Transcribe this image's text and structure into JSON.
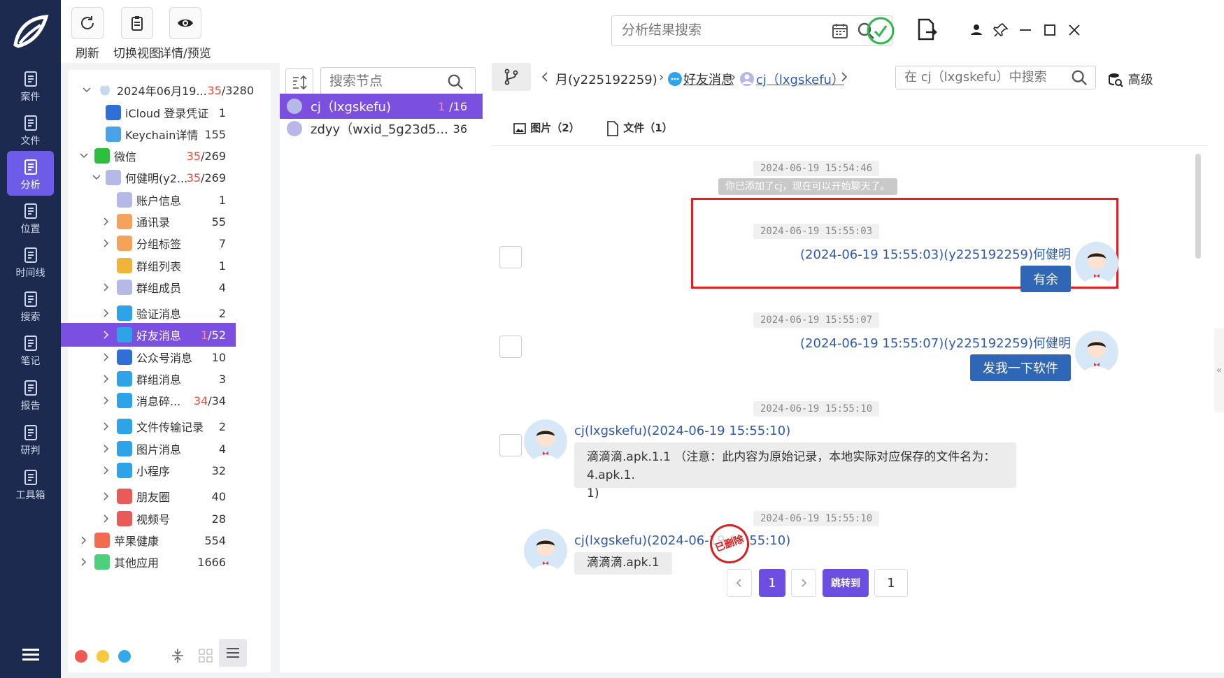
{
  "toolbar": {
    "refresh": "刷新",
    "switch_view": "切换视图",
    "detail_preview": "详情/预览",
    "search_placeholder": "分析结果搜索"
  },
  "nav": [
    {
      "label": "案件",
      "icon": "case-icon"
    },
    {
      "label": "文件",
      "icon": "folder-icon"
    },
    {
      "label": "分析",
      "icon": "analysis-icon",
      "active": true
    },
    {
      "label": "位置",
      "icon": "location-icon"
    },
    {
      "label": "时间线",
      "icon": "timeline-icon"
    },
    {
      "label": "搜索",
      "icon": "search-icon"
    },
    {
      "label": "笔记",
      "icon": "note-icon"
    },
    {
      "label": "报告",
      "icon": "report-icon"
    },
    {
      "label": "研判",
      "icon": "judge-icon"
    },
    {
      "label": "工具箱",
      "icon": "toolbox-icon"
    }
  ],
  "tree": {
    "root": {
      "label": "2024年06月19...",
      "count_red": "35",
      "count": "/3280"
    },
    "items": [
      {
        "label": "iCloud 登录凭证",
        "count": "1",
        "level": 2,
        "color": "#2f6fd6"
      },
      {
        "label": "Keychain详情",
        "count": "155",
        "level": 2,
        "color": "#4aa3e8"
      },
      {
        "label": "微信",
        "count_red": "35",
        "count": "/269",
        "level": 1,
        "color": "#2fbf3f"
      },
      {
        "label": "何健明(y2...",
        "count_red": "35",
        "count": "/269",
        "level": 2,
        "color": "#b6b8e8"
      },
      {
        "label": "账户信息",
        "count": "1",
        "level": 3,
        "color": "#b6b8e8"
      },
      {
        "label": "通讯录",
        "count": "55",
        "level": 3,
        "color": "#f5a35a"
      },
      {
        "label": "分组标签",
        "count": "7",
        "level": 3,
        "color": "#f5a35a"
      },
      {
        "label": "群组列表",
        "count": "1",
        "level": 3,
        "color": "#f0b43c"
      },
      {
        "label": "群组成员",
        "count": "4",
        "level": 3,
        "color": "#b6b8e8"
      },
      {
        "label": "验证消息",
        "count": "2",
        "level": 3,
        "color": "#2ea3e8"
      },
      {
        "label": "好友消息",
        "count_red": "1",
        "count": "/52",
        "level": 3,
        "color": "#2ea3e8",
        "selected": true
      },
      {
        "label": "公众号消息",
        "count": "10",
        "level": 3,
        "color": "#2f6fd6"
      },
      {
        "label": "群组消息",
        "count": "3",
        "level": 3,
        "color": "#2ea3e8"
      },
      {
        "label": "消息碎...",
        "count_red": "34",
        "count": "/34",
        "level": 3,
        "color": "#2ea3e8"
      },
      {
        "label": "文件传输记录",
        "count": "2",
        "level": 3,
        "color": "#2ea3e8"
      },
      {
        "label": "图片消息",
        "count": "4",
        "level": 3,
        "color": "#2ea3e8"
      },
      {
        "label": "小程序",
        "count": "32",
        "level": 3,
        "color": "#2ea3e8"
      },
      {
        "label": "朋友圈",
        "count": "40",
        "level": 3,
        "color": "#e85b5b"
      },
      {
        "label": "视频号",
        "count": "28",
        "level": 3,
        "color": "#e85b5b"
      },
      {
        "label": "苹果健康",
        "count": "554",
        "level": 1,
        "color": "#f26b50"
      },
      {
        "label": "其他应用",
        "count": "1666",
        "level": 1,
        "color": "#4cd07a"
      }
    ]
  },
  "contacts": {
    "search_placeholder": "搜索节点",
    "items": [
      {
        "label": "cj（lxgskefu)",
        "count_red": "1",
        "count": "/16",
        "selected": true
      },
      {
        "label": "zdyy（wxid_5g23d5...",
        "count": "36"
      }
    ]
  },
  "chat": {
    "crumb_account": "月(y225192259)",
    "crumb_category": "好友消息",
    "crumb_contact": "cj（lxgskefu）",
    "search_placeholder": "在 cj（lxgskefu）中搜索",
    "advanced": "高级",
    "tab_images": "图片（2）",
    "tab_files": "文件（1）",
    "messages": [
      {
        "ts": "2024-06-19 15:54:46",
        "system": "你已添加了cj，现在可以开始聊天了。"
      },
      {
        "ts": "2024-06-19 15:55:03",
        "sender": "(2024-06-19 15:55:03)(y225192259)何健明",
        "text": "有余",
        "dir": "out"
      },
      {
        "ts": "2024-06-19 15:55:07",
        "sender": "(2024-06-19 15:55:07)(y225192259)何健明",
        "text": "发我一下软件",
        "dir": "out"
      },
      {
        "ts": "2024-06-19 15:55:10",
        "sender": "cj(lxgskefu)(2024-06-19 15:55:10)",
        "text": "滴滴滴.apk.1.1 （注意：此内容为原始记录，本地实际对应保存的文件名为：4.apk.1.",
        "text2": "1)",
        "dir": "in"
      },
      {
        "ts": "2024-06-19 15:55:10",
        "sender": "cj(lxgskefu)(2024-06-19 15:55:10)",
        "text": "滴滴滴.apk.1",
        "dir": "in",
        "stamp": "已删除"
      }
    ],
    "pager": {
      "current": "1",
      "jump": "跳转到",
      "jump_value": "1"
    }
  }
}
